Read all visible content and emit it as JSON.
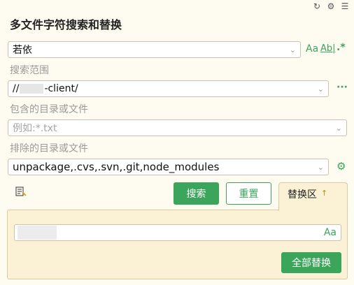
{
  "header": {
    "title": "多文件字符搜索和替换",
    "icons": [
      "refresh-icon",
      "settings-icon",
      "menu-icon"
    ]
  },
  "search": {
    "query": "若依",
    "option_icons": {
      "match_case": "Aa",
      "whole_word": "Ab|",
      "regex": ".*"
    }
  },
  "scope": {
    "label": "搜索范围",
    "value_prefix": "//",
    "value_suffix": "-client/",
    "more": "···"
  },
  "include": {
    "label": "包含的目录或文件",
    "placeholder": "例如:*.txt"
  },
  "exclude": {
    "label": "排除的目录或文件",
    "value": "unpackage,.cvs,.svn,.git,node_modules"
  },
  "actions": {
    "search": "搜索",
    "reset": "重置",
    "replace_tab": "替换区",
    "replace_tab_arrow": "↑"
  },
  "replace": {
    "case_icon": "Aa",
    "replace_all": "全部替换"
  },
  "colors": {
    "accent": "#3ba55c",
    "background": "#fefbf0",
    "panel": "#fbf2d6"
  }
}
